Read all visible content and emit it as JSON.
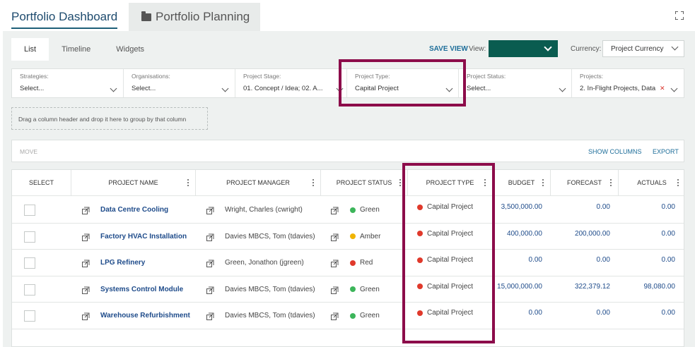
{
  "tabs": {
    "dashboard": "Portfolio Dashboard",
    "planning": "Portfolio Planning"
  },
  "subtabs": [
    "List",
    "Timeline",
    "Widgets"
  ],
  "view_controls": {
    "save_view": "SAVE VIEW",
    "view_label": "View:",
    "view_value": "",
    "currency_label": "Currency:",
    "currency_value": "Project Currency"
  },
  "filters": [
    {
      "label": "Strategies:",
      "value": "Select..."
    },
    {
      "label": "Organisations:",
      "value": "Select..."
    },
    {
      "label": "Project Stage:",
      "value": "01. Concept / Idea; 02. A..."
    },
    {
      "label": "Project Type:",
      "value": "Capital Project"
    },
    {
      "label": "Project Status:",
      "value": "Select..."
    },
    {
      "label": "Projects:",
      "value": "2. In-Flight Projects, Data"
    }
  ],
  "group_hint": "Drag a column header and drop it here to group by that column",
  "toolbar": {
    "move": "MOVE",
    "show_columns": "SHOW COLUMNS",
    "export": "EXPORT"
  },
  "columns": [
    "SELECT",
    "PROJECT NAME",
    "PROJECT MANAGER",
    "PROJECT STATUS",
    "PROJECT TYPE",
    "BUDGET",
    "FORECAST",
    "ACTUALS"
  ],
  "colors": {
    "green": "#3cb55a",
    "amber": "#f0b400",
    "red": "#e0392b",
    "accent": "#1e6e9a",
    "highlight": "#8c0c4a"
  },
  "rows": [
    {
      "name": "Data Centre Cooling",
      "manager": "Wright, Charles (cwright)",
      "status": "Green",
      "type": "Capital Project",
      "budget": "3,500,000.00",
      "forecast": "0.00",
      "actuals": "0.00"
    },
    {
      "name": "Factory HVAC Installation",
      "manager": "Davies MBCS, Tom (tdavies)",
      "status": "Amber",
      "type": "Capital Project",
      "budget": "400,000.00",
      "forecast": "200,000.00",
      "actuals": "0.00"
    },
    {
      "name": "LPG Refinery",
      "manager": "Green, Jonathon (jgreen)",
      "status": "Red",
      "type": "Capital Project",
      "budget": "0.00",
      "forecast": "0.00",
      "actuals": "0.00"
    },
    {
      "name": "Systems Control Module",
      "manager": "Davies MBCS, Tom (tdavies)",
      "status": "Green",
      "type": "Capital Project",
      "budget": "15,000,000.00",
      "forecast": "322,379.12",
      "actuals": "98,080.00"
    },
    {
      "name": "Warehouse Refurbishment",
      "manager": "Davies MBCS, Tom (tdavies)",
      "status": "Green",
      "type": "Capital Project",
      "budget": "0.00",
      "forecast": "0.00",
      "actuals": "0.00"
    }
  ]
}
